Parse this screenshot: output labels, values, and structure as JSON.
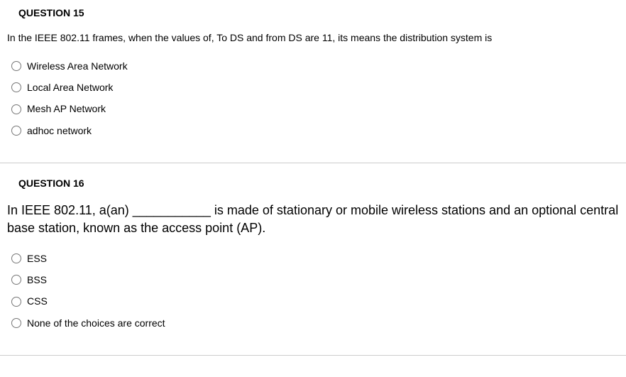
{
  "questions": [
    {
      "header": "QUESTION 15",
      "text": "In the IEEE 802.11 frames, when the values of, To DS and from DS are 11, its means the distribution system is",
      "textStyle": "small",
      "options": [
        "Wireless Area Network",
        "Local Area Network",
        "Mesh AP Network",
        "adhoc network"
      ]
    },
    {
      "header": "QUESTION 16",
      "text": "In IEEE 802.11, a(an) ___________ is made of stationary or mobile wireless stations and an optional central base station, known as the access point (AP).",
      "textStyle": "large",
      "options": [
        "ESS",
        "BSS",
        "CSS",
        "None of the choices are correct"
      ]
    }
  ]
}
